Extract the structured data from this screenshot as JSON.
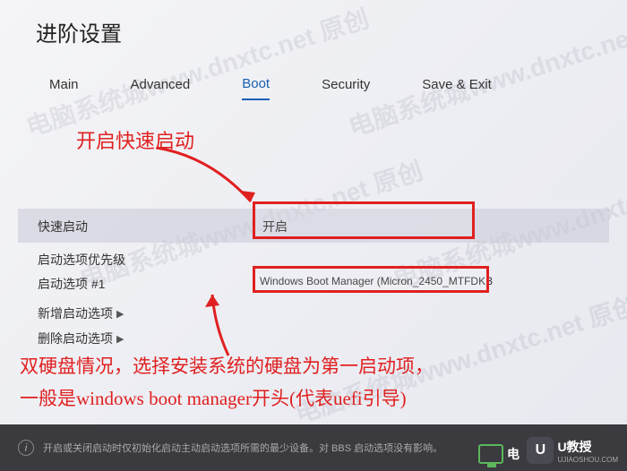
{
  "page_title": "进阶设置",
  "tabs": {
    "main": "Main",
    "advanced": "Advanced",
    "boot": "Boot",
    "security": "Security",
    "save_exit": "Save & Exit"
  },
  "annotations": {
    "a1": "开启快速启动",
    "a2_line1": "双硬盘情况，选择安装系统的硬盘为第一启动项，",
    "a2_line2": "一般是windows boot manager开头(代表uefi引导)"
  },
  "rows": {
    "fast_boot": {
      "label": "快速启动",
      "value": "开启"
    },
    "boot_priority": {
      "label": "启动选项优先级"
    },
    "boot_option_1": {
      "label": "启动选项 #1",
      "value": "Windows Boot Manager (Micron_2450_MTFDKB"
    },
    "add_option": {
      "label": "新增启动选项"
    },
    "delete_option": {
      "label": "删除启动选项"
    }
  },
  "footer": {
    "text": "开启或关闭启动时仅初始化启动主动启动选项所需的最少设备。对 BBS 启动选项没有影响。"
  },
  "watermark": "电脑系统城www.dnxtc.net 原创",
  "logos": {
    "dian": "电",
    "u": "U",
    "u_text": "U教授",
    "u_sub": "UJIAOSHOU.COM"
  }
}
